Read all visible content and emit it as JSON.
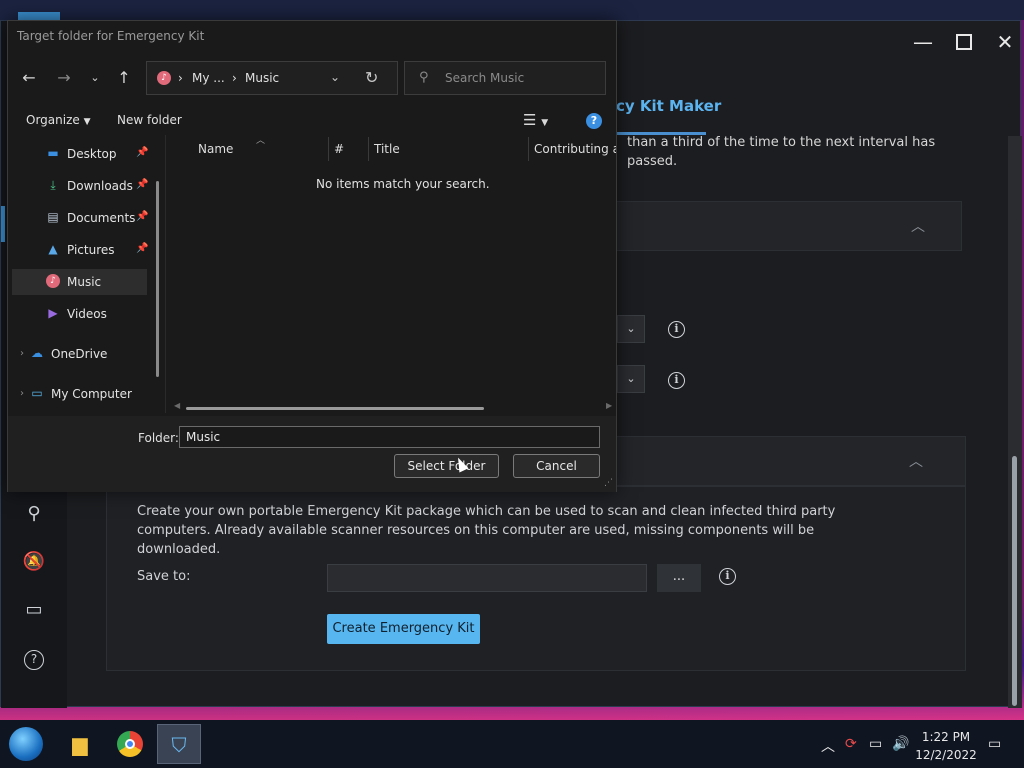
{
  "dialog": {
    "title": "Target folder for Emergency Kit",
    "address": {
      "part1": "My ...",
      "part2": "Music"
    },
    "search_placeholder": "Search Music",
    "toolbar": {
      "organize": "Organize",
      "new_folder": "New folder"
    },
    "nav": [
      {
        "label": "Desktop",
        "icon": "desktop-icon",
        "pinned": true
      },
      {
        "label": "Downloads",
        "icon": "downloads-icon",
        "pinned": true
      },
      {
        "label": "Documents",
        "icon": "documents-icon",
        "pinned": true
      },
      {
        "label": "Pictures",
        "icon": "pictures-icon",
        "pinned": true
      },
      {
        "label": "Music",
        "icon": "music-icon",
        "selected": true
      },
      {
        "label": "Videos",
        "icon": "videos-icon"
      },
      {
        "label": "OneDrive",
        "icon": "onedrive-icon"
      },
      {
        "label": "My Computer",
        "icon": "computer-icon"
      }
    ],
    "columns": [
      "Name",
      "#",
      "Title",
      "Contributing ar"
    ],
    "empty_message": "No items match your search.",
    "folder_label": "Folder:",
    "folder_value": "Music",
    "select_button": "Select Folder",
    "cancel_button": "Cancel"
  },
  "app": {
    "title": "cy Kit Maker",
    "top_text": "than a third of the time to the next interval has passed.",
    "description": "Create your own portable Emergency Kit package which can be used to scan and clean infected third party computers. Already available scanner resources on this computer are used, missing components will be downloaded.",
    "save_to_label": "Save to:",
    "save_to_value": "",
    "browse_label": "...",
    "create_button": "Create Emergency Kit",
    "accent_color": "#57b6ef"
  },
  "taskbar": {
    "time": "1:22 PM",
    "date": "12/2/2022"
  }
}
